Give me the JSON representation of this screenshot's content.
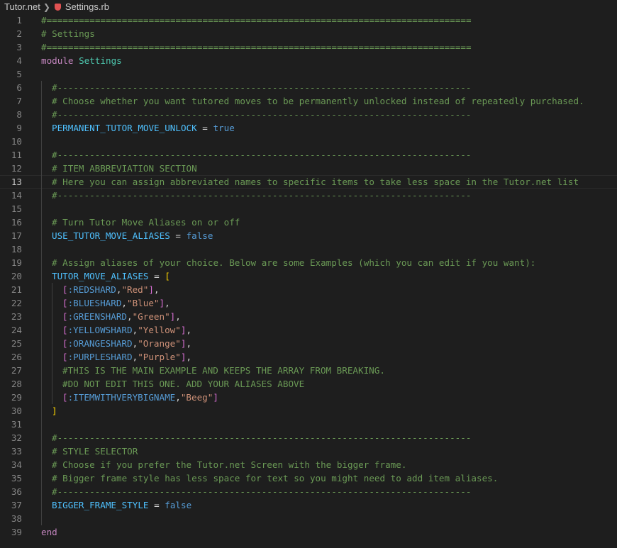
{
  "breadcrumb": {
    "folder": "Tutor.net",
    "file": "Settings.rb",
    "file_icon": "ruby-file-icon"
  },
  "editor": {
    "current_line": 13,
    "lines": [
      {
        "n": "1",
        "indent": 0,
        "tokens": [
          {
            "t": "comment",
            "v": "#==============================================================================="
          }
        ]
      },
      {
        "n": "2",
        "indent": 0,
        "tokens": [
          {
            "t": "comment",
            "v": "# Settings"
          }
        ]
      },
      {
        "n": "3",
        "indent": 0,
        "tokens": [
          {
            "t": "comment",
            "v": "#==============================================================================="
          }
        ]
      },
      {
        "n": "4",
        "indent": 0,
        "tokens": [
          {
            "t": "keyword",
            "v": "module"
          },
          {
            "t": "op",
            "v": " "
          },
          {
            "t": "module",
            "v": "Settings"
          }
        ]
      },
      {
        "n": "5",
        "indent": 0,
        "tokens": []
      },
      {
        "n": "6",
        "indent": 1,
        "tokens": [
          {
            "t": "comment",
            "v": "#-----------------------------------------------------------------------------"
          }
        ]
      },
      {
        "n": "7",
        "indent": 1,
        "tokens": [
          {
            "t": "comment",
            "v": "# Choose whether you want tutored moves to be permanently unlocked instead of repeatedly purchased."
          }
        ]
      },
      {
        "n": "8",
        "indent": 1,
        "tokens": [
          {
            "t": "comment",
            "v": "#-----------------------------------------------------------------------------"
          }
        ]
      },
      {
        "n": "9",
        "indent": 1,
        "tokens": [
          {
            "t": "const",
            "v": "PERMANENT_TUTOR_MOVE_UNLOCK"
          },
          {
            "t": "op",
            "v": " = "
          },
          {
            "t": "bool",
            "v": "true"
          }
        ]
      },
      {
        "n": "10",
        "indent": 1,
        "tokens": []
      },
      {
        "n": "11",
        "indent": 1,
        "tokens": [
          {
            "t": "comment",
            "v": "#-----------------------------------------------------------------------------"
          }
        ]
      },
      {
        "n": "12",
        "indent": 1,
        "tokens": [
          {
            "t": "comment",
            "v": "# ITEM ABBREVIATION SECTION"
          }
        ]
      },
      {
        "n": "13",
        "indent": 1,
        "tokens": [
          {
            "t": "comment",
            "v": "# Here you can assign abbreviated names to specific items to take less space in the Tutor.net list"
          }
        ]
      },
      {
        "n": "14",
        "indent": 1,
        "tokens": [
          {
            "t": "comment",
            "v": "#-----------------------------------------------------------------------------"
          }
        ]
      },
      {
        "n": "15",
        "indent": 1,
        "tokens": []
      },
      {
        "n": "16",
        "indent": 1,
        "tokens": [
          {
            "t": "comment",
            "v": "# Turn Tutor Move Aliases on or off"
          }
        ]
      },
      {
        "n": "17",
        "indent": 1,
        "tokens": [
          {
            "t": "const",
            "v": "USE_TUTOR_MOVE_ALIASES"
          },
          {
            "t": "op",
            "v": " = "
          },
          {
            "t": "bool",
            "v": "false"
          }
        ]
      },
      {
        "n": "18",
        "indent": 1,
        "tokens": []
      },
      {
        "n": "19",
        "indent": 1,
        "tokens": [
          {
            "t": "comment",
            "v": "# Assign aliases of your choice. Below are some Examples (which you can edit if you want):"
          }
        ]
      },
      {
        "n": "20",
        "indent": 1,
        "tokens": [
          {
            "t": "const",
            "v": "TUTOR_MOVE_ALIASES"
          },
          {
            "t": "op",
            "v": " = "
          },
          {
            "t": "bracket1",
            "v": "["
          }
        ]
      },
      {
        "n": "21",
        "indent": 2,
        "tokens": [
          {
            "t": "bracket2",
            "v": "["
          },
          {
            "t": "symbol",
            "v": ":REDSHARD"
          },
          {
            "t": "op",
            "v": ","
          },
          {
            "t": "string",
            "v": "\"Red\""
          },
          {
            "t": "bracket2",
            "v": "]"
          },
          {
            "t": "op",
            "v": ","
          }
        ]
      },
      {
        "n": "22",
        "indent": 2,
        "tokens": [
          {
            "t": "bracket2",
            "v": "["
          },
          {
            "t": "symbol",
            "v": ":BLUESHARD"
          },
          {
            "t": "op",
            "v": ","
          },
          {
            "t": "string",
            "v": "\"Blue\""
          },
          {
            "t": "bracket2",
            "v": "]"
          },
          {
            "t": "op",
            "v": ","
          }
        ]
      },
      {
        "n": "23",
        "indent": 2,
        "tokens": [
          {
            "t": "bracket2",
            "v": "["
          },
          {
            "t": "symbol",
            "v": ":GREENSHARD"
          },
          {
            "t": "op",
            "v": ","
          },
          {
            "t": "string",
            "v": "\"Green\""
          },
          {
            "t": "bracket2",
            "v": "]"
          },
          {
            "t": "op",
            "v": ","
          }
        ]
      },
      {
        "n": "24",
        "indent": 2,
        "tokens": [
          {
            "t": "bracket2",
            "v": "["
          },
          {
            "t": "symbol",
            "v": ":YELLOWSHARD"
          },
          {
            "t": "op",
            "v": ","
          },
          {
            "t": "string",
            "v": "\"Yellow\""
          },
          {
            "t": "bracket2",
            "v": "]"
          },
          {
            "t": "op",
            "v": ","
          }
        ]
      },
      {
        "n": "25",
        "indent": 2,
        "tokens": [
          {
            "t": "bracket2",
            "v": "["
          },
          {
            "t": "symbol",
            "v": ":ORANGESHARD"
          },
          {
            "t": "op",
            "v": ","
          },
          {
            "t": "string",
            "v": "\"Orange\""
          },
          {
            "t": "bracket2",
            "v": "]"
          },
          {
            "t": "op",
            "v": ","
          }
        ]
      },
      {
        "n": "26",
        "indent": 2,
        "tokens": [
          {
            "t": "bracket2",
            "v": "["
          },
          {
            "t": "symbol",
            "v": ":PURPLESHARD"
          },
          {
            "t": "op",
            "v": ","
          },
          {
            "t": "string",
            "v": "\"Purple\""
          },
          {
            "t": "bracket2",
            "v": "]"
          },
          {
            "t": "op",
            "v": ","
          }
        ]
      },
      {
        "n": "27",
        "indent": 2,
        "tokens": [
          {
            "t": "comment",
            "v": "#THIS IS THE MAIN EXAMPLE AND KEEPS THE ARRAY FROM BREAKING."
          }
        ]
      },
      {
        "n": "28",
        "indent": 2,
        "tokens": [
          {
            "t": "comment",
            "v": "#DO NOT EDIT THIS ONE. ADD YOUR ALIASES ABOVE"
          }
        ]
      },
      {
        "n": "29",
        "indent": 2,
        "tokens": [
          {
            "t": "bracket2",
            "v": "["
          },
          {
            "t": "symbol",
            "v": ":ITEMWITHVERYBIGNAME"
          },
          {
            "t": "op",
            "v": ","
          },
          {
            "t": "string",
            "v": "\"Beeg\""
          },
          {
            "t": "bracket2",
            "v": "]"
          }
        ]
      },
      {
        "n": "30",
        "indent": 1,
        "tokens": [
          {
            "t": "bracket1",
            "v": "]"
          }
        ]
      },
      {
        "n": "31",
        "indent": 1,
        "tokens": []
      },
      {
        "n": "32",
        "indent": 1,
        "tokens": [
          {
            "t": "comment",
            "v": "#-----------------------------------------------------------------------------"
          }
        ]
      },
      {
        "n": "33",
        "indent": 1,
        "tokens": [
          {
            "t": "comment",
            "v": "# STYLE SELECTOR"
          }
        ]
      },
      {
        "n": "34",
        "indent": 1,
        "tokens": [
          {
            "t": "comment",
            "v": "# Choose if you prefer the Tutor.net Screen with the bigger frame."
          }
        ]
      },
      {
        "n": "35",
        "indent": 1,
        "tokens": [
          {
            "t": "comment",
            "v": "# Bigger frame style has less space for text so you might need to add item aliases."
          }
        ]
      },
      {
        "n": "36",
        "indent": 1,
        "tokens": [
          {
            "t": "comment",
            "v": "#-----------------------------------------------------------------------------"
          }
        ]
      },
      {
        "n": "37",
        "indent": 1,
        "tokens": [
          {
            "t": "const",
            "v": "BIGGER_FRAME_STYLE"
          },
          {
            "t": "op",
            "v": " = "
          },
          {
            "t": "bool",
            "v": "false"
          }
        ]
      },
      {
        "n": "38",
        "indent": 1,
        "tokens": []
      },
      {
        "n": "39",
        "indent": 0,
        "tokens": [
          {
            "t": "keyword",
            "v": "end"
          }
        ]
      }
    ]
  },
  "colors": {
    "background": "#1e1e1e",
    "comment": "#6a9955",
    "keyword": "#c586c0",
    "module": "#4ec9b0",
    "constant": "#4fc1ff",
    "boolean": "#569cd6",
    "string": "#ce9178",
    "bracket_level1": "#ffd700",
    "bracket_level2": "#da70d6"
  }
}
